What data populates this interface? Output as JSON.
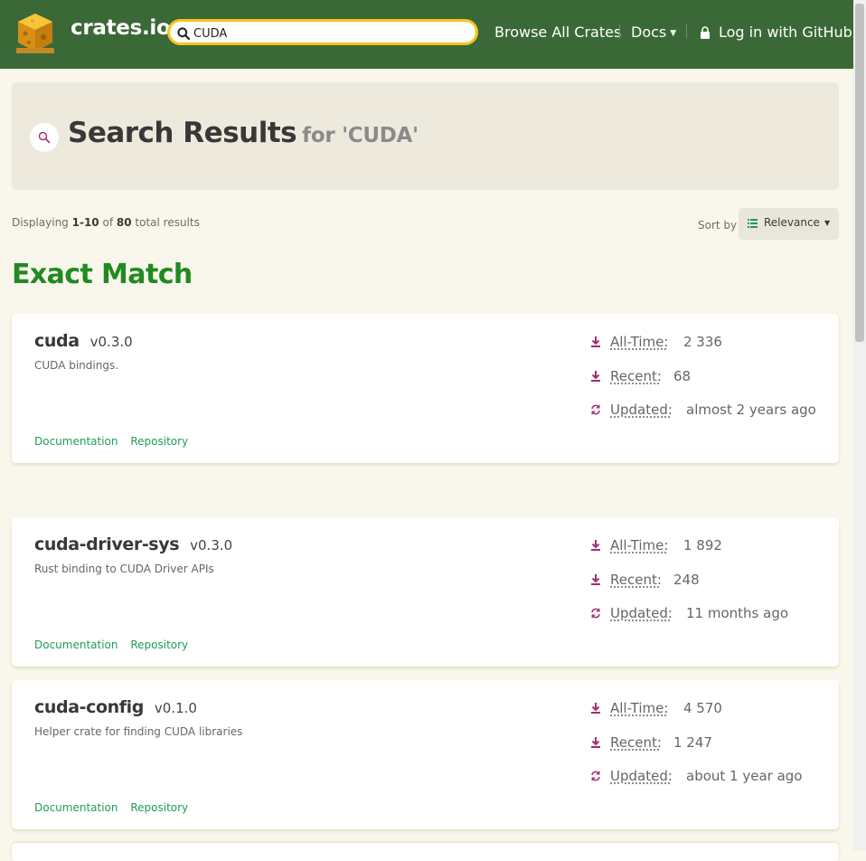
{
  "header": {
    "brand": "crates.io",
    "search_value": "CUDA",
    "nav": {
      "browse": "Browse All Crates",
      "docs": "Docs",
      "login": "Log in with GitHub"
    }
  },
  "hero": {
    "title": "Search Results",
    "subtitle": "for 'CUDA'"
  },
  "results": {
    "prefix": "Displaying",
    "range": "1-10",
    "of": "of",
    "total": "80",
    "suffix": "total results"
  },
  "sort": {
    "label": "Sort by",
    "value": "Relevance"
  },
  "section_title": "Exact Match",
  "crates": [
    {
      "name": "cuda",
      "version": "v0.3.0",
      "description": "CUDA bindings.",
      "all_time_label": "All-Time:",
      "all_time": "2 336",
      "recent_label": "Recent:",
      "recent": "68",
      "updated_label": "Updated:",
      "updated": "almost 2 years ago",
      "links": [
        "Documentation",
        "Repository"
      ]
    },
    {
      "name": "cuda-driver-sys",
      "version": "v0.3.0",
      "description": "Rust binding to CUDA Driver APIs",
      "all_time_label": "All-Time:",
      "all_time": "1 892",
      "recent_label": "Recent:",
      "recent": "248",
      "updated_label": "Updated:",
      "updated": "11 months ago",
      "links": [
        "Documentation",
        "Repository"
      ]
    },
    {
      "name": "cuda-config",
      "version": "v0.1.0",
      "description": "Helper crate for finding CUDA libraries",
      "all_time_label": "All-Time:",
      "all_time": "4 570",
      "recent_label": "Recent:",
      "recent": "1 247",
      "updated_label": "Updated:",
      "updated": "about 1 year ago",
      "links": [
        "Documentation",
        "Repository"
      ]
    }
  ],
  "colors": {
    "header_bg": "#3b6837",
    "search_border": "#f9c31a",
    "page_bg": "#f9f7ec",
    "hero_bg": "#edeadd",
    "exact_match": "#218a21",
    "link": "#1f9d55",
    "stat_icon": "#a0306b"
  }
}
